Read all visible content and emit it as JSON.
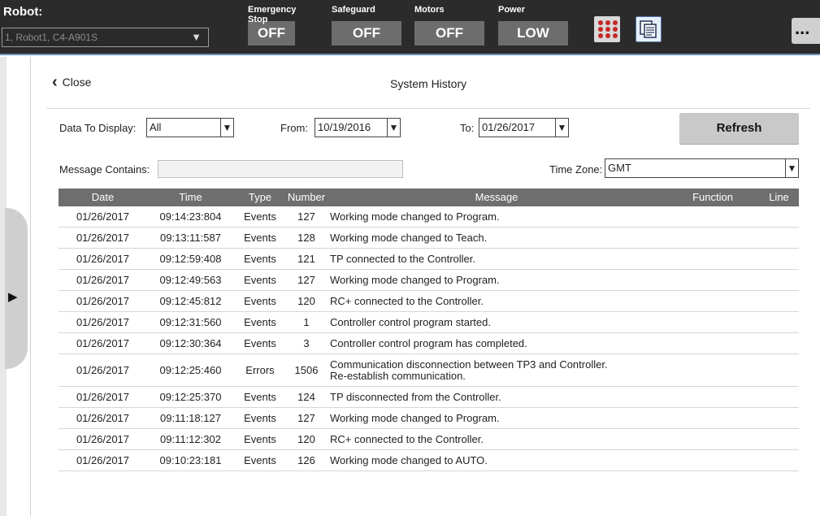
{
  "topbar": {
    "robot_label": "Robot:",
    "robot_value": "1, Robot1, C4-A901S",
    "statuses": [
      {
        "label": "Emergency Stop",
        "value": "OFF"
      },
      {
        "label": "Safeguard",
        "value": "OFF"
      },
      {
        "label": "Motors",
        "value": "OFF"
      },
      {
        "label": "Power",
        "value": "LOW"
      }
    ],
    "more": "..."
  },
  "header": {
    "close_label": "Close",
    "title": "System History"
  },
  "filters": {
    "data_to_display_label": "Data To Display:",
    "data_to_display_value": "All",
    "from_label": "From:",
    "from_value": "10/19/2016",
    "to_label": "To:",
    "to_value": "01/26/2017",
    "refresh_label": "Refresh",
    "message_contains_label": "Message Contains:",
    "message_contains_value": "",
    "time_zone_label": "Time Zone:",
    "time_zone_value": "GMT"
  },
  "table": {
    "columns": [
      "Date",
      "Time",
      "Type",
      "Number",
      "Message",
      "Function",
      "Line"
    ],
    "rows": [
      {
        "date": "01/26/2017",
        "time": "09:14:23:804",
        "type": "Events",
        "number": "127",
        "message": "Working mode changed to Program.",
        "function": "",
        "line": ""
      },
      {
        "date": "01/26/2017",
        "time": "09:13:11:587",
        "type": "Events",
        "number": "128",
        "message": "Working mode changed to Teach.",
        "function": "",
        "line": ""
      },
      {
        "date": "01/26/2017",
        "time": "09:12:59:408",
        "type": "Events",
        "number": "121",
        "message": "TP connected to the Controller.",
        "function": "",
        "line": ""
      },
      {
        "date": "01/26/2017",
        "time": "09:12:49:563",
        "type": "Events",
        "number": "127",
        "message": "Working mode changed to Program.",
        "function": "",
        "line": ""
      },
      {
        "date": "01/26/2017",
        "time": "09:12:45:812",
        "type": "Events",
        "number": "120",
        "message": "RC+ connected to the Controller.",
        "function": "",
        "line": ""
      },
      {
        "date": "01/26/2017",
        "time": "09:12:31:560",
        "type": "Events",
        "number": "1",
        "message": "Controller control program started.",
        "function": "",
        "line": ""
      },
      {
        "date": "01/26/2017",
        "time": "09:12:30:364",
        "type": "Events",
        "number": "3",
        "message": "Controller control program has completed.",
        "function": "",
        "line": ""
      },
      {
        "date": "01/26/2017",
        "time": "09:12:25:460",
        "type": "Errors",
        "number": "1506",
        "message": "Communication disconnection between TP3 and Controller.\nRe-establish communication.",
        "function": "",
        "line": ""
      },
      {
        "date": "01/26/2017",
        "time": "09:12:25:370",
        "type": "Events",
        "number": "124",
        "message": "TP disconnected from the Controller.",
        "function": "",
        "line": ""
      },
      {
        "date": "01/26/2017",
        "time": "09:11:18:127",
        "type": "Events",
        "number": "127",
        "message": "Working mode changed to Program.",
        "function": "",
        "line": ""
      },
      {
        "date": "01/26/2017",
        "time": "09:11:12:302",
        "type": "Events",
        "number": "120",
        "message": "RC+ connected to the Controller.",
        "function": "",
        "line": ""
      },
      {
        "date": "01/26/2017",
        "time": "09:10:23:181",
        "type": "Events",
        "number": "126",
        "message": "Working mode changed to AUTO.",
        "function": "",
        "line": ""
      }
    ]
  }
}
